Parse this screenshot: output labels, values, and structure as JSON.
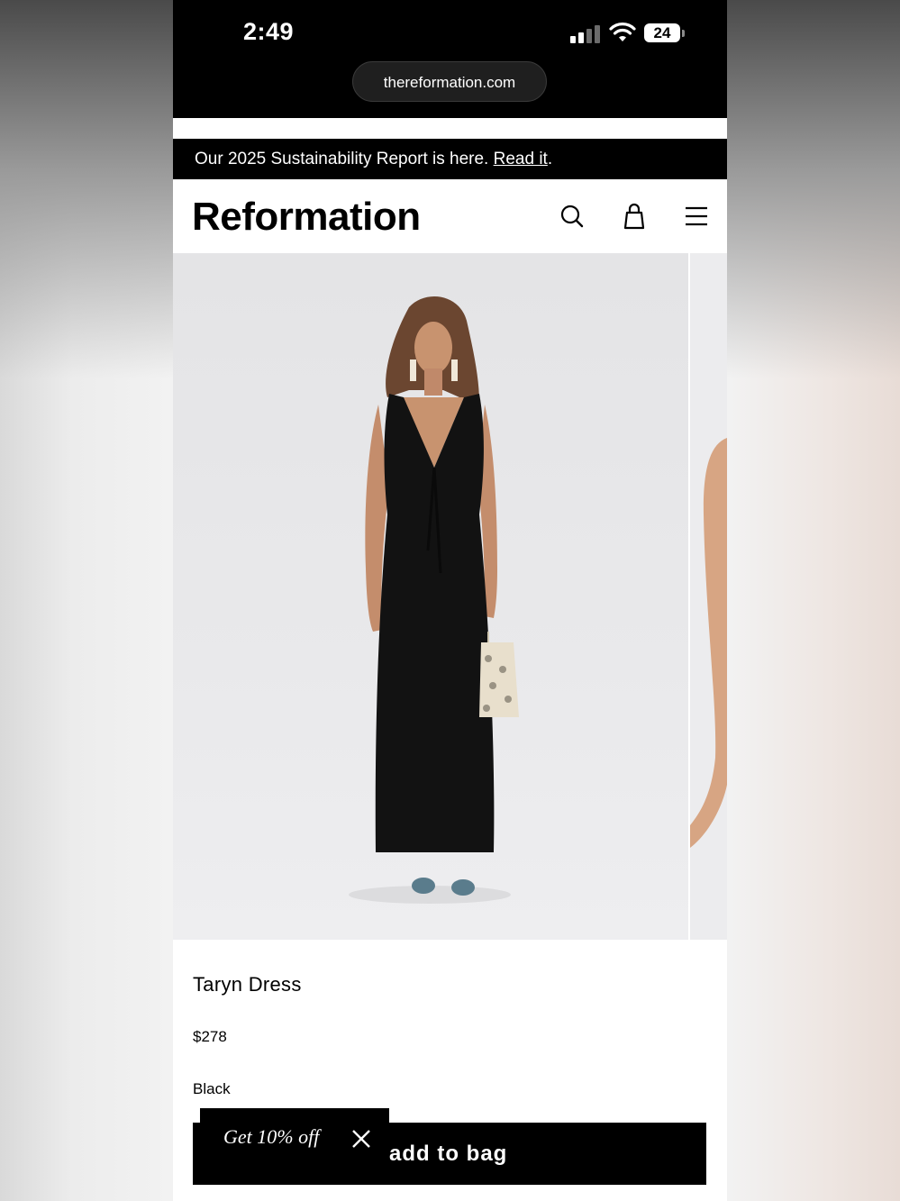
{
  "status_bar": {
    "time": "2:49",
    "battery": "24",
    "icons": [
      "signal-icon",
      "wifi-icon",
      "battery-icon"
    ]
  },
  "browser": {
    "url": "thereformation.com"
  },
  "announcement": {
    "text": "Our 2025 Sustainability Report is here. ",
    "link_label": "Read it",
    "suffix": "."
  },
  "header": {
    "logo": "Reformation",
    "icons": [
      "search-icon",
      "bag-icon",
      "menu-icon"
    ]
  },
  "product": {
    "name": "Taryn Dress",
    "price": "$278",
    "color": "Black",
    "add_to_bag_label": "add to bag"
  },
  "promo": {
    "label": "Get 10% off",
    "icon": "close-icon"
  },
  "colors": {
    "ink": "#000000",
    "paper": "#ffffff",
    "image_bg": "#e6e6e8"
  }
}
